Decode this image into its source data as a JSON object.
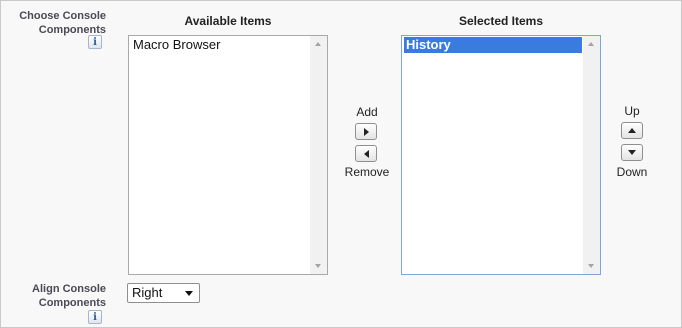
{
  "console_components": {
    "label_line1": "Choose Console",
    "label_line2": "Components",
    "info_glyph": "i",
    "available": {
      "heading": "Available Items",
      "items": [
        "Macro Browser"
      ]
    },
    "selected": {
      "heading": "Selected Items",
      "items": [
        "History"
      ],
      "selected_index": 0
    },
    "controls": {
      "add_label": "Add",
      "remove_label": "Remove",
      "up_label": "Up",
      "down_label": "Down"
    }
  },
  "align_components": {
    "label_line1": "Align Console",
    "label_line2": "Components",
    "info_glyph": "i",
    "selected_value": "Right"
  },
  "colors": {
    "selection": "#3a7be0",
    "info_icon": "#2f5a94"
  },
  "icons": {
    "info": "info-icon",
    "add": "arrow-right-icon",
    "remove": "arrow-left-icon",
    "up": "arrow-up-icon",
    "down": "arrow-down-icon",
    "dropdown": "chevron-down-icon"
  }
}
